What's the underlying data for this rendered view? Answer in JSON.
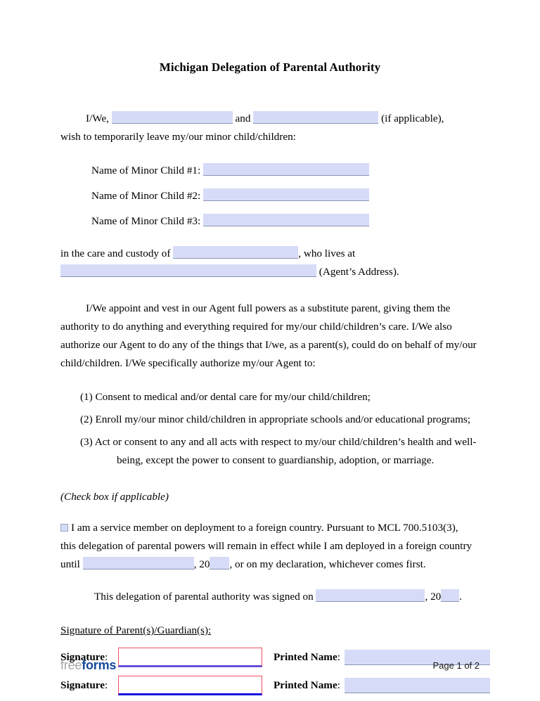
{
  "document": {
    "title": "Michigan Delegation of Parental Authority"
  },
  "intro": {
    "lead": "I/We,",
    "and": "and",
    "if_applicable": "(if applicable),",
    "second_line": "wish to temporarily leave my/our minor child/children:"
  },
  "children": [
    {
      "label": "Name of Minor Child #1:"
    },
    {
      "label": "Name of Minor Child #2:"
    },
    {
      "label": "Name of Minor Child #3:"
    }
  ],
  "custody": {
    "line1_prefix": "in the care and custody of",
    "line1_suffix": ", who lives at",
    "line2_suffix": "(Agent’s Address)."
  },
  "appointment": {
    "paragraph": "I/We appoint and vest in our Agent full powers as a substitute parent, giving them the authority to do anything and everything required for my/our child/children’s care. I/We also authorize our Agent to do any of the things that I/we, as a parent(s), could do on behalf of my/our child/children. I/We specifically authorize my/our Agent to:"
  },
  "powers": [
    {
      "number": "(1)",
      "text": "Consent to medical and/or dental care for my/our child/children;"
    },
    {
      "number": "(2)",
      "text": "Enroll my/our minor child/children in appropriate schools and/or educational programs;"
    },
    {
      "number": "(3)",
      "text": "Act or consent to any and all acts with respect to my/our child/children’s health and well-",
      "continuation": "being, except the power to consent to guardianship, adoption, or marriage."
    }
  ],
  "deployment": {
    "check_note": "(Check box if applicable)",
    "sentence_part1": "I am a service member on deployment to a foreign country. Pursuant to MCL 700.5103(3),",
    "sentence_part2": "this delegation of parental powers will remain in effect while I am deployed in a foreign country",
    "until_label": "until",
    "year_prefix": ", 20",
    "sentence_part3": ", or on my declaration, whichever comes first."
  },
  "signed_on": {
    "prefix": "This delegation of parental authority was signed on",
    "year_prefix": ", 20",
    "suffix": "."
  },
  "signature_section": {
    "heading": "Signature of Parent(s)/Guardian(s):",
    "rows": [
      {
        "signature_label": "Signature",
        "printed_name_label": "Printed Name"
      },
      {
        "signature_label": "Signature",
        "printed_name_label": "Printed Name"
      }
    ],
    "colon": ":"
  },
  "footer": {
    "logo_free": "free",
    "logo_forms": "forms",
    "page_indicator": "Page 1 of 2"
  },
  "colors": {
    "field_fill": "#d6dcf7",
    "field_border": "#8a93b4",
    "signature_border": "#ef4f63",
    "signature_underline_1": "#6a4fd8",
    "signature_underline_2": "#1515e0",
    "logo_gray": "#a5a5a5",
    "logo_blue": "#14489b"
  }
}
